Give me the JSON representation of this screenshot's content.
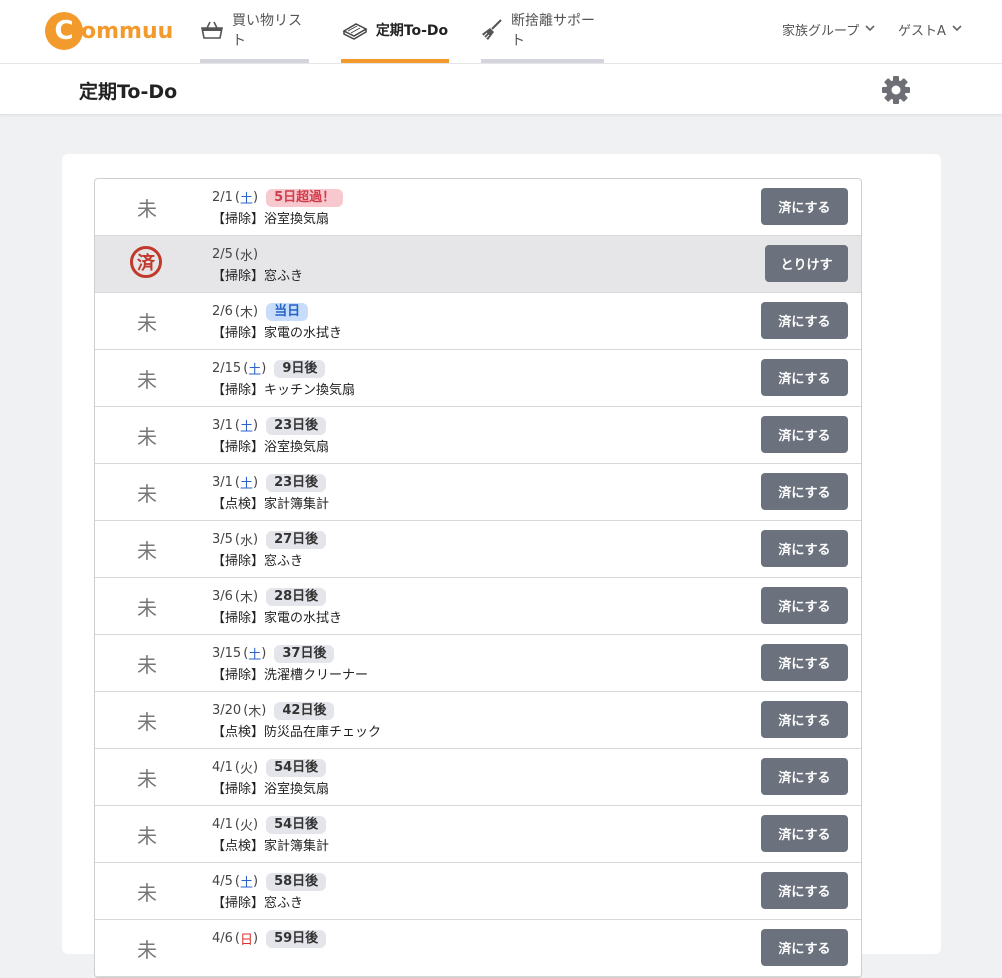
{
  "app": {
    "logo_letter": "C",
    "logo_text": "ommuu",
    "brand_color": "#f39a2d"
  },
  "nav": {
    "tabs": [
      {
        "label": "買い物リスト",
        "icon": "shopping-basket-icon",
        "active": false
      },
      {
        "label": "定期To-Do",
        "icon": "notebook-icon",
        "active": true
      },
      {
        "label": "断捨離サポート",
        "icon": "broom-icon",
        "active": false
      }
    ],
    "group_label": "家族グループ",
    "user_label": "ゲストA"
  },
  "page": {
    "title": "定期To-Do",
    "settings_icon": "gear-icon"
  },
  "todo": {
    "pending_status": "未",
    "done_status": "済",
    "done_button": "済にする",
    "undo_button": "とりけす",
    "items": [
      {
        "date": "2/1",
        "weekday": "土",
        "badge": "5日超過！",
        "badge_type": "over",
        "task": "【掃除】浴室換気扇",
        "done": false
      },
      {
        "date": "2/5",
        "weekday": "水",
        "badge": "",
        "badge_type": "",
        "task": "【掃除】窓ふき",
        "done": true
      },
      {
        "date": "2/6",
        "weekday": "木",
        "badge": "当日",
        "badge_type": "today",
        "task": "【掃除】家電の水拭き",
        "done": false
      },
      {
        "date": "2/15",
        "weekday": "土",
        "badge": "9日後",
        "badge_type": "normal",
        "task": "【掃除】キッチン換気扇",
        "done": false
      },
      {
        "date": "3/1",
        "weekday": "土",
        "badge": "23日後",
        "badge_type": "normal",
        "task": "【掃除】浴室換気扇",
        "done": false
      },
      {
        "date": "3/1",
        "weekday": "土",
        "badge": "23日後",
        "badge_type": "normal",
        "task": "【点検】家計簿集計",
        "done": false
      },
      {
        "date": "3/5",
        "weekday": "水",
        "badge": "27日後",
        "badge_type": "normal",
        "task": "【掃除】窓ふき",
        "done": false
      },
      {
        "date": "3/6",
        "weekday": "木",
        "badge": "28日後",
        "badge_type": "normal",
        "task": "【掃除】家電の水拭き",
        "done": false
      },
      {
        "date": "3/15",
        "weekday": "土",
        "badge": "37日後",
        "badge_type": "normal",
        "task": "【掃除】洗濯槽クリーナー",
        "done": false
      },
      {
        "date": "3/20",
        "weekday": "木",
        "badge": "42日後",
        "badge_type": "normal",
        "task": "【点検】防災品在庫チェック",
        "done": false
      },
      {
        "date": "4/1",
        "weekday": "火",
        "badge": "54日後",
        "badge_type": "normal",
        "task": "【掃除】浴室換気扇",
        "done": false
      },
      {
        "date": "4/1",
        "weekday": "火",
        "badge": "54日後",
        "badge_type": "normal",
        "task": "【点検】家計簿集計",
        "done": false
      },
      {
        "date": "4/5",
        "weekday": "土",
        "badge": "58日後",
        "badge_type": "normal",
        "task": "【掃除】窓ふき",
        "done": false
      },
      {
        "date": "4/6",
        "weekday": "日",
        "badge": "59日後",
        "badge_type": "normal",
        "task": "",
        "done": false
      }
    ]
  }
}
